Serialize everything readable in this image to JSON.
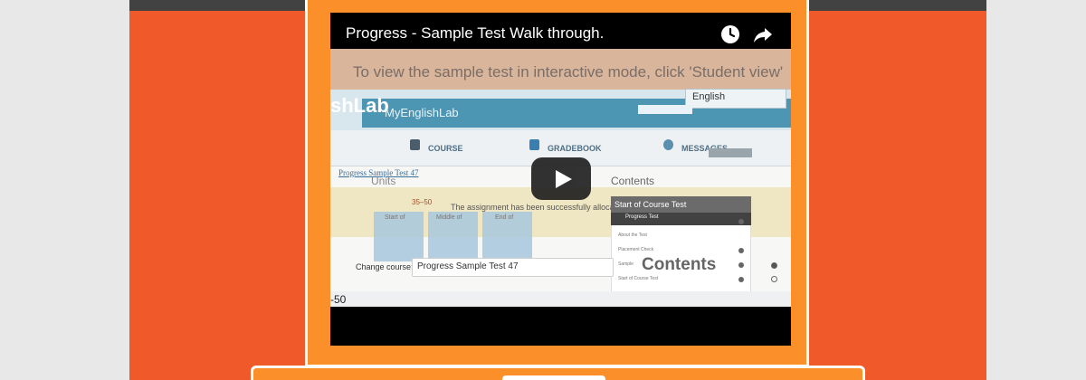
{
  "video": {
    "title": "Progress - Sample Test Walk through.",
    "watch_later_icon": "clock-icon",
    "share_icon": "share-icon",
    "play_icon": "play-icon"
  },
  "thumbnail": {
    "banner": "To view the sample test in interactive mode, click 'Student view'",
    "logo_big": "shLab",
    "logo_small": "MyEnglishLab",
    "language": "English",
    "nav": [
      "COURSE",
      "GRADEBOOK",
      "MESSAGES"
    ],
    "breadcrumb": "Progress Sample Test 47",
    "units": "Units",
    "contents_heading": "Contents",
    "score_range": "35–50",
    "assignment_msg": "The assignment has been successfully allocat",
    "tiles": [
      "Start of",
      "Middle of",
      "End of"
    ],
    "panel_title": "Start of Course Test",
    "panel_sub": "Progress Test",
    "panel_rows": [
      "About the Test",
      "Placement Check",
      "Sample",
      "Start of Course Test"
    ],
    "change_course_label": "Change course:",
    "selected_course": "Progress Sample Test 47",
    "contents_overlay": "Contents",
    "num": "-50"
  },
  "colors": {
    "page_bg": "#f05a2a",
    "frame": "#fb8f2a",
    "top_bar": "#424242"
  }
}
